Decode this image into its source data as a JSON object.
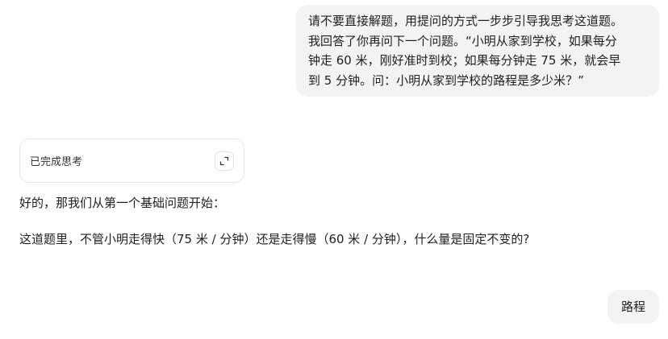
{
  "conversation": {
    "user_message_1": {
      "lines": [
        "请不要直接解题，用提问的方式一步步引导我思考这道题。",
        "我回答了你再问下一个问题。“小明从家到学校，如果每分",
        "钟走 60 米，刚好准时到校；如果每分钟走 75 米，就会早",
        "到 5 分钟。问：小明从家到学校的路程是多少米？”"
      ]
    },
    "thinking": {
      "label": "已完成思考",
      "expand_icon": "expand-icon"
    },
    "assistant_reply": {
      "line_1": "好的，那我们从第一个基础问题开始：",
      "line_2": "这道题里，不管小明走得快（75 米 / 分钟）还是走得慢（60 米 / 分钟），什么量是固定不变的?"
    },
    "user_message_2": {
      "text": "路程"
    }
  },
  "colors": {
    "user_bubble_bg": "#f3f3f3",
    "text": "#1f1f1f",
    "card_border": "#e6e6e6"
  }
}
